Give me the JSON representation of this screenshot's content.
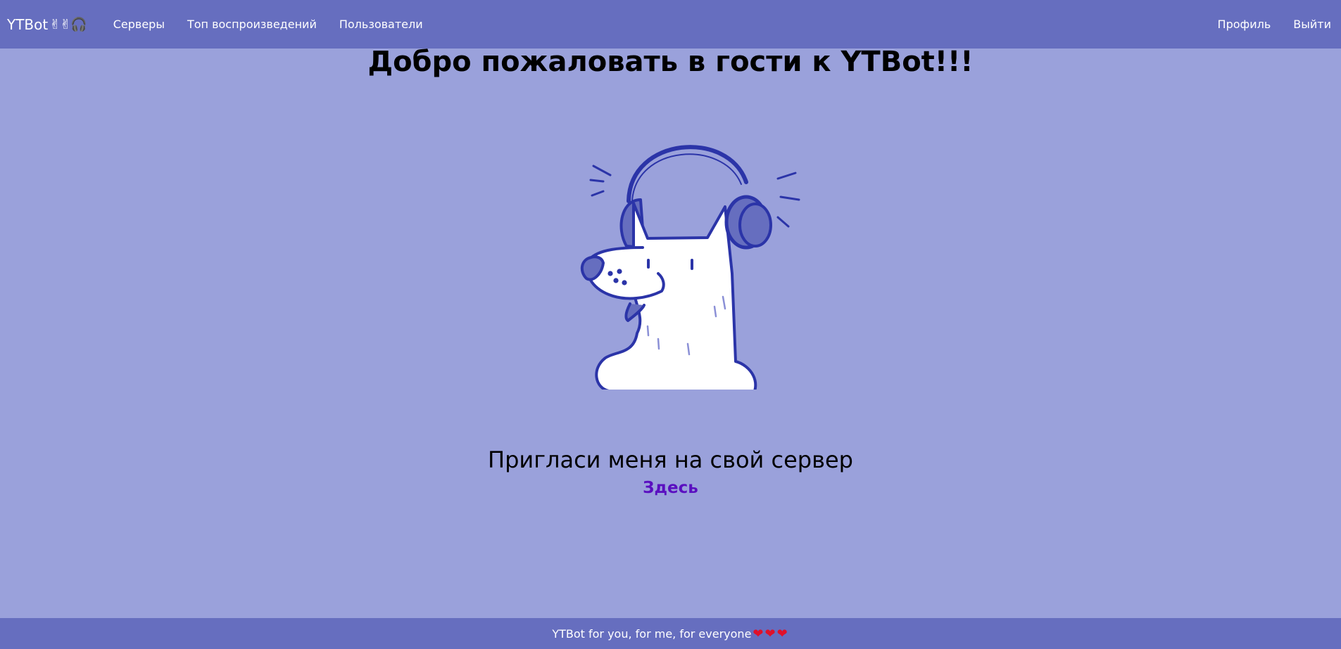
{
  "nav": {
    "brand": "YTBot",
    "brand_emoji": "✌✌🎧",
    "links": [
      {
        "label": "Серверы"
      },
      {
        "label": "Топ воспроизведений"
      },
      {
        "label": "Пользователи"
      }
    ],
    "right_links": [
      {
        "label": "Профиль"
      },
      {
        "label": "Выйти"
      }
    ]
  },
  "main": {
    "welcome_title": "Добро пожаловать в гости к YTBot!!!",
    "mascot_icon": "dog-with-headphones-icon",
    "invite_text": "Пригласи меня на свой сервер",
    "invite_link": "Здесь"
  },
  "footer": {
    "text": "YTBot for you, for me, for everyone",
    "hearts": "❤❤❤"
  },
  "colors": {
    "navbar": "#666ebf",
    "background": "#9aa1db",
    "link": "#5a0fc0",
    "mascot_outline": "#2b34a8"
  }
}
